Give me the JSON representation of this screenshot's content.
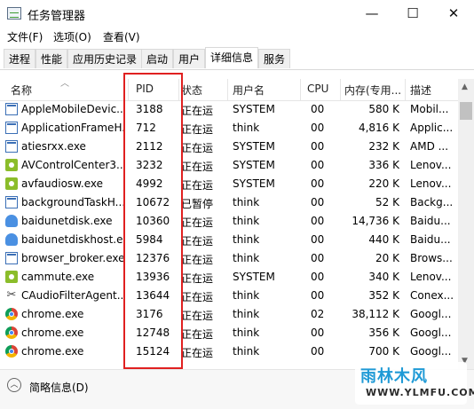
{
  "window": {
    "title": "任务管理器",
    "minimize": "—",
    "maximize": "☐",
    "close": "✕"
  },
  "menu": [
    "文件(F)",
    "选项(O)",
    "查看(V)"
  ],
  "tabs": [
    "进程",
    "性能",
    "应用历史记录",
    "启动",
    "用户",
    "详细信息",
    "服务"
  ],
  "active_tab": "详细信息",
  "columns": [
    "名称",
    "PID",
    "状态",
    "用户名",
    "CPU",
    "内存(专用...",
    "描述"
  ],
  "rows": [
    {
      "icon": "app-window-icon",
      "name": "AppleMobileDevic...",
      "pid": "3188",
      "status": "正在运",
      "user": "SYSTEM",
      "cpu": "00",
      "mem": "580 K",
      "desc": "Mobil..."
    },
    {
      "icon": "app-window-icon",
      "name": "ApplicationFrameH...",
      "pid": "712",
      "status": "正在运",
      "user": "think",
      "cpu": "00",
      "mem": "4,816 K",
      "desc": "Applic..."
    },
    {
      "icon": "app-window-icon",
      "name": "atiesrxx.exe",
      "pid": "2112",
      "status": "正在运",
      "user": "SYSTEM",
      "cpu": "00",
      "mem": "232 K",
      "desc": "AMD ..."
    },
    {
      "icon": "gear-icon",
      "name": "AVControlCenter3...",
      "pid": "3232",
      "status": "正在运",
      "user": "SYSTEM",
      "cpu": "00",
      "mem": "336 K",
      "desc": "Lenov..."
    },
    {
      "icon": "gear-icon",
      "name": "avfaudiosw.exe",
      "pid": "4992",
      "status": "正在运",
      "user": "SYSTEM",
      "cpu": "00",
      "mem": "220 K",
      "desc": "Lenov..."
    },
    {
      "icon": "app-window-icon",
      "name": "backgroundTaskH...",
      "pid": "10672",
      "status": "已暂停",
      "user": "think",
      "cpu": "00",
      "mem": "52 K",
      "desc": "Backg..."
    },
    {
      "icon": "cloud-icon",
      "name": "baidunetdisk.exe",
      "pid": "10360",
      "status": "正在运",
      "user": "think",
      "cpu": "00",
      "mem": "14,736 K",
      "desc": "Baidu..."
    },
    {
      "icon": "cloud-icon",
      "name": "baidunetdiskhost.e...",
      "pid": "5984",
      "status": "正在运",
      "user": "think",
      "cpu": "00",
      "mem": "440 K",
      "desc": "Baidu..."
    },
    {
      "icon": "app-window-icon",
      "name": "browser_broker.exe",
      "pid": "12376",
      "status": "正在运",
      "user": "think",
      "cpu": "00",
      "mem": "20 K",
      "desc": "Brows..."
    },
    {
      "icon": "gear-icon",
      "name": "cammute.exe",
      "pid": "13936",
      "status": "正在运",
      "user": "SYSTEM",
      "cpu": "00",
      "mem": "340 K",
      "desc": "Lenov..."
    },
    {
      "icon": "tools-icon",
      "name": "CAudioFilterAgent...",
      "pid": "13644",
      "status": "正在运",
      "user": "think",
      "cpu": "00",
      "mem": "352 K",
      "desc": "Conex..."
    },
    {
      "icon": "chrome-icon",
      "name": "chrome.exe",
      "pid": "3176",
      "status": "正在运",
      "user": "think",
      "cpu": "02",
      "mem": "38,112 K",
      "desc": "Googl..."
    },
    {
      "icon": "chrome-icon",
      "name": "chrome.exe",
      "pid": "12748",
      "status": "正在运",
      "user": "think",
      "cpu": "00",
      "mem": "356 K",
      "desc": "Googl..."
    },
    {
      "icon": "chrome-icon",
      "name": "chrome.exe",
      "pid": "15124",
      "status": "正在运",
      "user": "think",
      "cpu": "00",
      "mem": "700 K",
      "desc": "Googl..."
    }
  ],
  "footer": {
    "label": "简略信息(D)",
    "icon": "chevron-up-icon"
  },
  "watermark": {
    "logo": "雨林木风",
    "url": "WWW.YLMFU.COM"
  },
  "colors": {
    "highlight": "#e02020"
  }
}
